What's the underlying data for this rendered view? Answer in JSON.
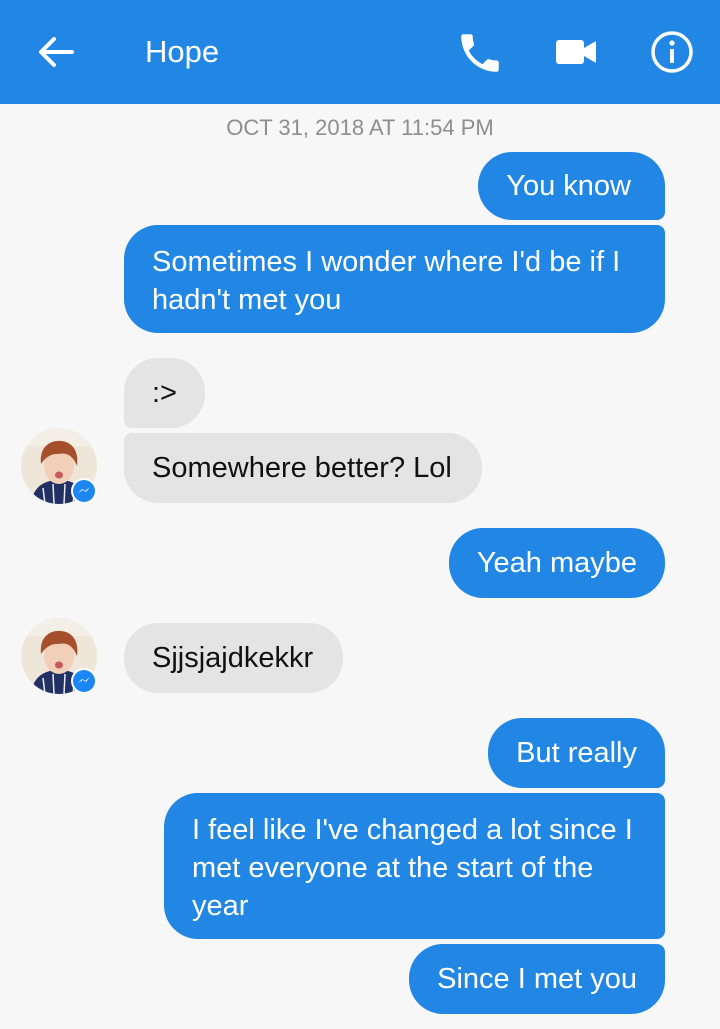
{
  "header": {
    "contact_name": "Hope",
    "back_icon": "arrow-left-icon",
    "call_icon": "phone-icon",
    "video_icon": "video-camera-icon",
    "info_icon": "info-icon",
    "accent_color": "#2287e4"
  },
  "conversation": {
    "timestamp": "OCT 31, 2018 AT 11:54 PM",
    "messages": [
      {
        "sender": "me",
        "text": "You know"
      },
      {
        "sender": "me",
        "text": "Sometimes I wonder where I'd be if I hadn't met you"
      },
      {
        "sender": "them",
        "text": ":>"
      },
      {
        "sender": "them",
        "text": "Somewhere better? Lol"
      },
      {
        "sender": "me",
        "text": "Yeah maybe"
      },
      {
        "sender": "them",
        "text": "Sjjsjajdkekkr"
      },
      {
        "sender": "me",
        "text": "But really"
      },
      {
        "sender": "me",
        "text": "I feel like I've changed a lot since I met everyone at the start of the year"
      },
      {
        "sender": "me",
        "text": "Since I met you"
      }
    ],
    "outgoing_color": "#2287e4",
    "incoming_color": "#e4e4e4"
  }
}
